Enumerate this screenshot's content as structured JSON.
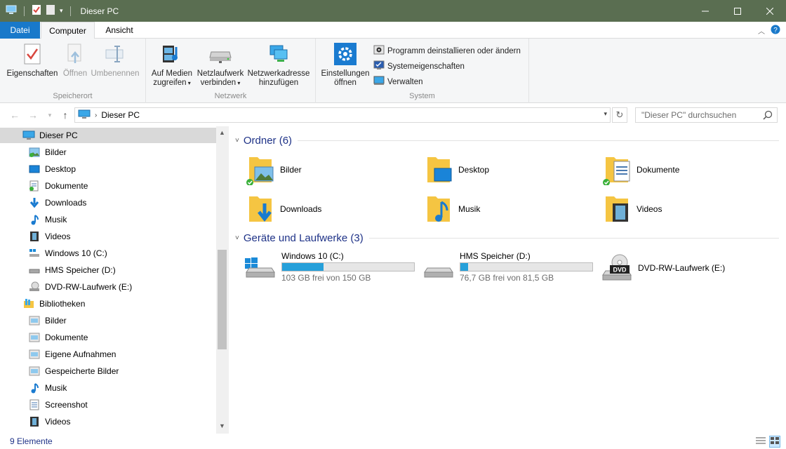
{
  "window": {
    "title": "Dieser PC",
    "title_bg": "#5a6e51"
  },
  "tabs": {
    "file": "Datei",
    "computer": "Computer",
    "view": "Ansicht"
  },
  "ribbon": {
    "groups": {
      "location": "Speicherort",
      "network": "Netzwerk",
      "system": "System"
    },
    "properties": "Eigenschaften",
    "open": "Öffnen",
    "rename": "Umbenennen",
    "media_line1": "Auf Medien",
    "media_line2": "zugreifen",
    "netdrive_line1": "Netzlaufwerk",
    "netdrive_line2": "verbinden",
    "netaddr_line1": "Netzwerkadresse",
    "netaddr_line2": "hinzufügen",
    "settings_line1": "Einstellungen",
    "settings_line2": "öffnen",
    "uninstall": "Programm deinstallieren oder ändern",
    "sysprops": "Systemeigenschaften",
    "manage": "Verwalten"
  },
  "address": {
    "path": "Dieser PC",
    "search_placeholder": "\"Dieser PC\" durchsuchen"
  },
  "nav": {
    "items": [
      {
        "label": "Dieser PC",
        "icon": "computer-icon"
      },
      {
        "label": "Bilder",
        "icon": "pictures-icon"
      },
      {
        "label": "Desktop",
        "icon": "desktop-icon"
      },
      {
        "label": "Dokumente",
        "icon": "documents-icon"
      },
      {
        "label": "Downloads",
        "icon": "downloads-icon"
      },
      {
        "label": "Musik",
        "icon": "music-icon"
      },
      {
        "label": "Videos",
        "icon": "videos-icon"
      },
      {
        "label": "Windows 10 (C:)",
        "icon": "windows-drive-icon"
      },
      {
        "label": "HMS Speicher (D:)",
        "icon": "drive-icon"
      },
      {
        "label": "DVD-RW-Laufwerk (E:)",
        "icon": "dvd-drive-icon"
      },
      {
        "label": "Bibliotheken",
        "icon": "libraries-icon"
      },
      {
        "label": "Bilder",
        "icon": "library-pictures-icon"
      },
      {
        "label": "Dokumente",
        "icon": "library-documents-icon"
      },
      {
        "label": "Eigene Aufnahmen",
        "icon": "library-camera-roll-icon"
      },
      {
        "label": "Gespeicherte Bilder",
        "icon": "library-saved-pictures-icon"
      },
      {
        "label": "Musik",
        "icon": "library-music-icon"
      },
      {
        "label": "Screenshot",
        "icon": "library-screenshot-icon"
      },
      {
        "label": "Videos",
        "icon": "library-videos-icon"
      }
    ]
  },
  "content": {
    "folders_header": "Ordner (6)",
    "drives_header": "Geräte und Laufwerke (3)",
    "folders": [
      {
        "label": "Bilder",
        "icon": "pictures-folder-icon"
      },
      {
        "label": "Desktop",
        "icon": "desktop-folder-icon"
      },
      {
        "label": "Dokumente",
        "icon": "documents-folder-icon"
      },
      {
        "label": "Downloads",
        "icon": "downloads-folder-icon"
      },
      {
        "label": "Musik",
        "icon": "music-folder-icon"
      },
      {
        "label": "Videos",
        "icon": "videos-folder-icon"
      }
    ],
    "drives": [
      {
        "name": "Windows 10 (C:)",
        "free": "103 GB frei von 150 GB",
        "used_fraction": 0.313
      },
      {
        "name": "HMS Speicher (D:)",
        "free": "76,7 GB frei von 81,5 GB",
        "used_fraction": 0.059
      },
      {
        "name": "DVD-RW-Laufwerk (E:)",
        "dvd_label": "DVD"
      }
    ]
  },
  "status": {
    "count": "9 Elemente"
  }
}
